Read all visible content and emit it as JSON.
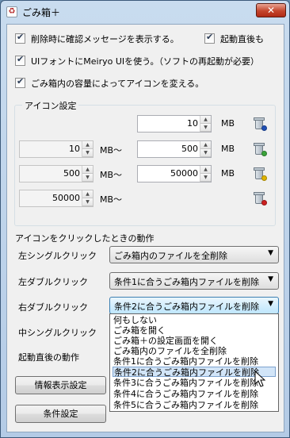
{
  "window": {
    "title": "ごみ箱＋",
    "close_glyph": "✕"
  },
  "options": {
    "confirm_delete": {
      "label": "削除時に確認メッセージを表示する。",
      "checked": true
    },
    "startup": {
      "label": "起動直後も",
      "checked": true
    },
    "meiryo": {
      "label": "UIフォントにMeiryo UIを使う。（ソフトの再起動が必要）",
      "checked": true
    },
    "icon_by_capacity": {
      "label": "ごみ箱内の容量によってアイコンを変える。",
      "checked": true
    }
  },
  "icon_settings": {
    "title": "アイコン設定",
    "unit": "MB",
    "range_suffix": "MB～",
    "rows": [
      {
        "from": "",
        "to": "10",
        "icon": "trash-empty-icon",
        "dot_color": "#1f4fb5"
      },
      {
        "from": "10",
        "to": "500",
        "icon": "trash-low-icon",
        "dot_color": "#3aa33a"
      },
      {
        "from": "500",
        "to": "50000",
        "icon": "trash-mid-icon",
        "dot_color": "#e0b400"
      },
      {
        "from": "50000",
        "to": "",
        "icon": "trash-full-icon",
        "dot_color": "#cc2020"
      }
    ]
  },
  "click_actions": {
    "title": "アイコンをクリックしたときの動作",
    "left_single": {
      "label": "左シングルクリック",
      "value": "ごみ箱内のファイルを全削除"
    },
    "left_double": {
      "label": "左ダブルクリック",
      "value": "条件1に合うごみ箱内ファイルを削除"
    },
    "right_double": {
      "label": "右ダブルクリック",
      "value": "条件2に合うごみ箱内ファイルを削除"
    },
    "middle_single": {
      "label": "中シングルクリック"
    },
    "startup_action": {
      "label": "起動直後の動作"
    }
  },
  "dropdown_options": [
    "何もしない",
    "ごみ箱を開く",
    "ごみ箱＋の設定画面を開く",
    "ごみ箱内のファイルを全削除",
    "条件1に合うごみ箱内ファイルを削除",
    "条件2に合うごみ箱内ファイルを削除",
    "条件3に合うごみ箱内ファイルを削除",
    "条件4に合うごみ箱内ファイルを削除",
    "条件5に合うごみ箱内ファイルを削除"
  ],
  "dropdown_selected_index": 5,
  "buttons": {
    "info": "情報表示設定",
    "conditions": "条件設定"
  }
}
